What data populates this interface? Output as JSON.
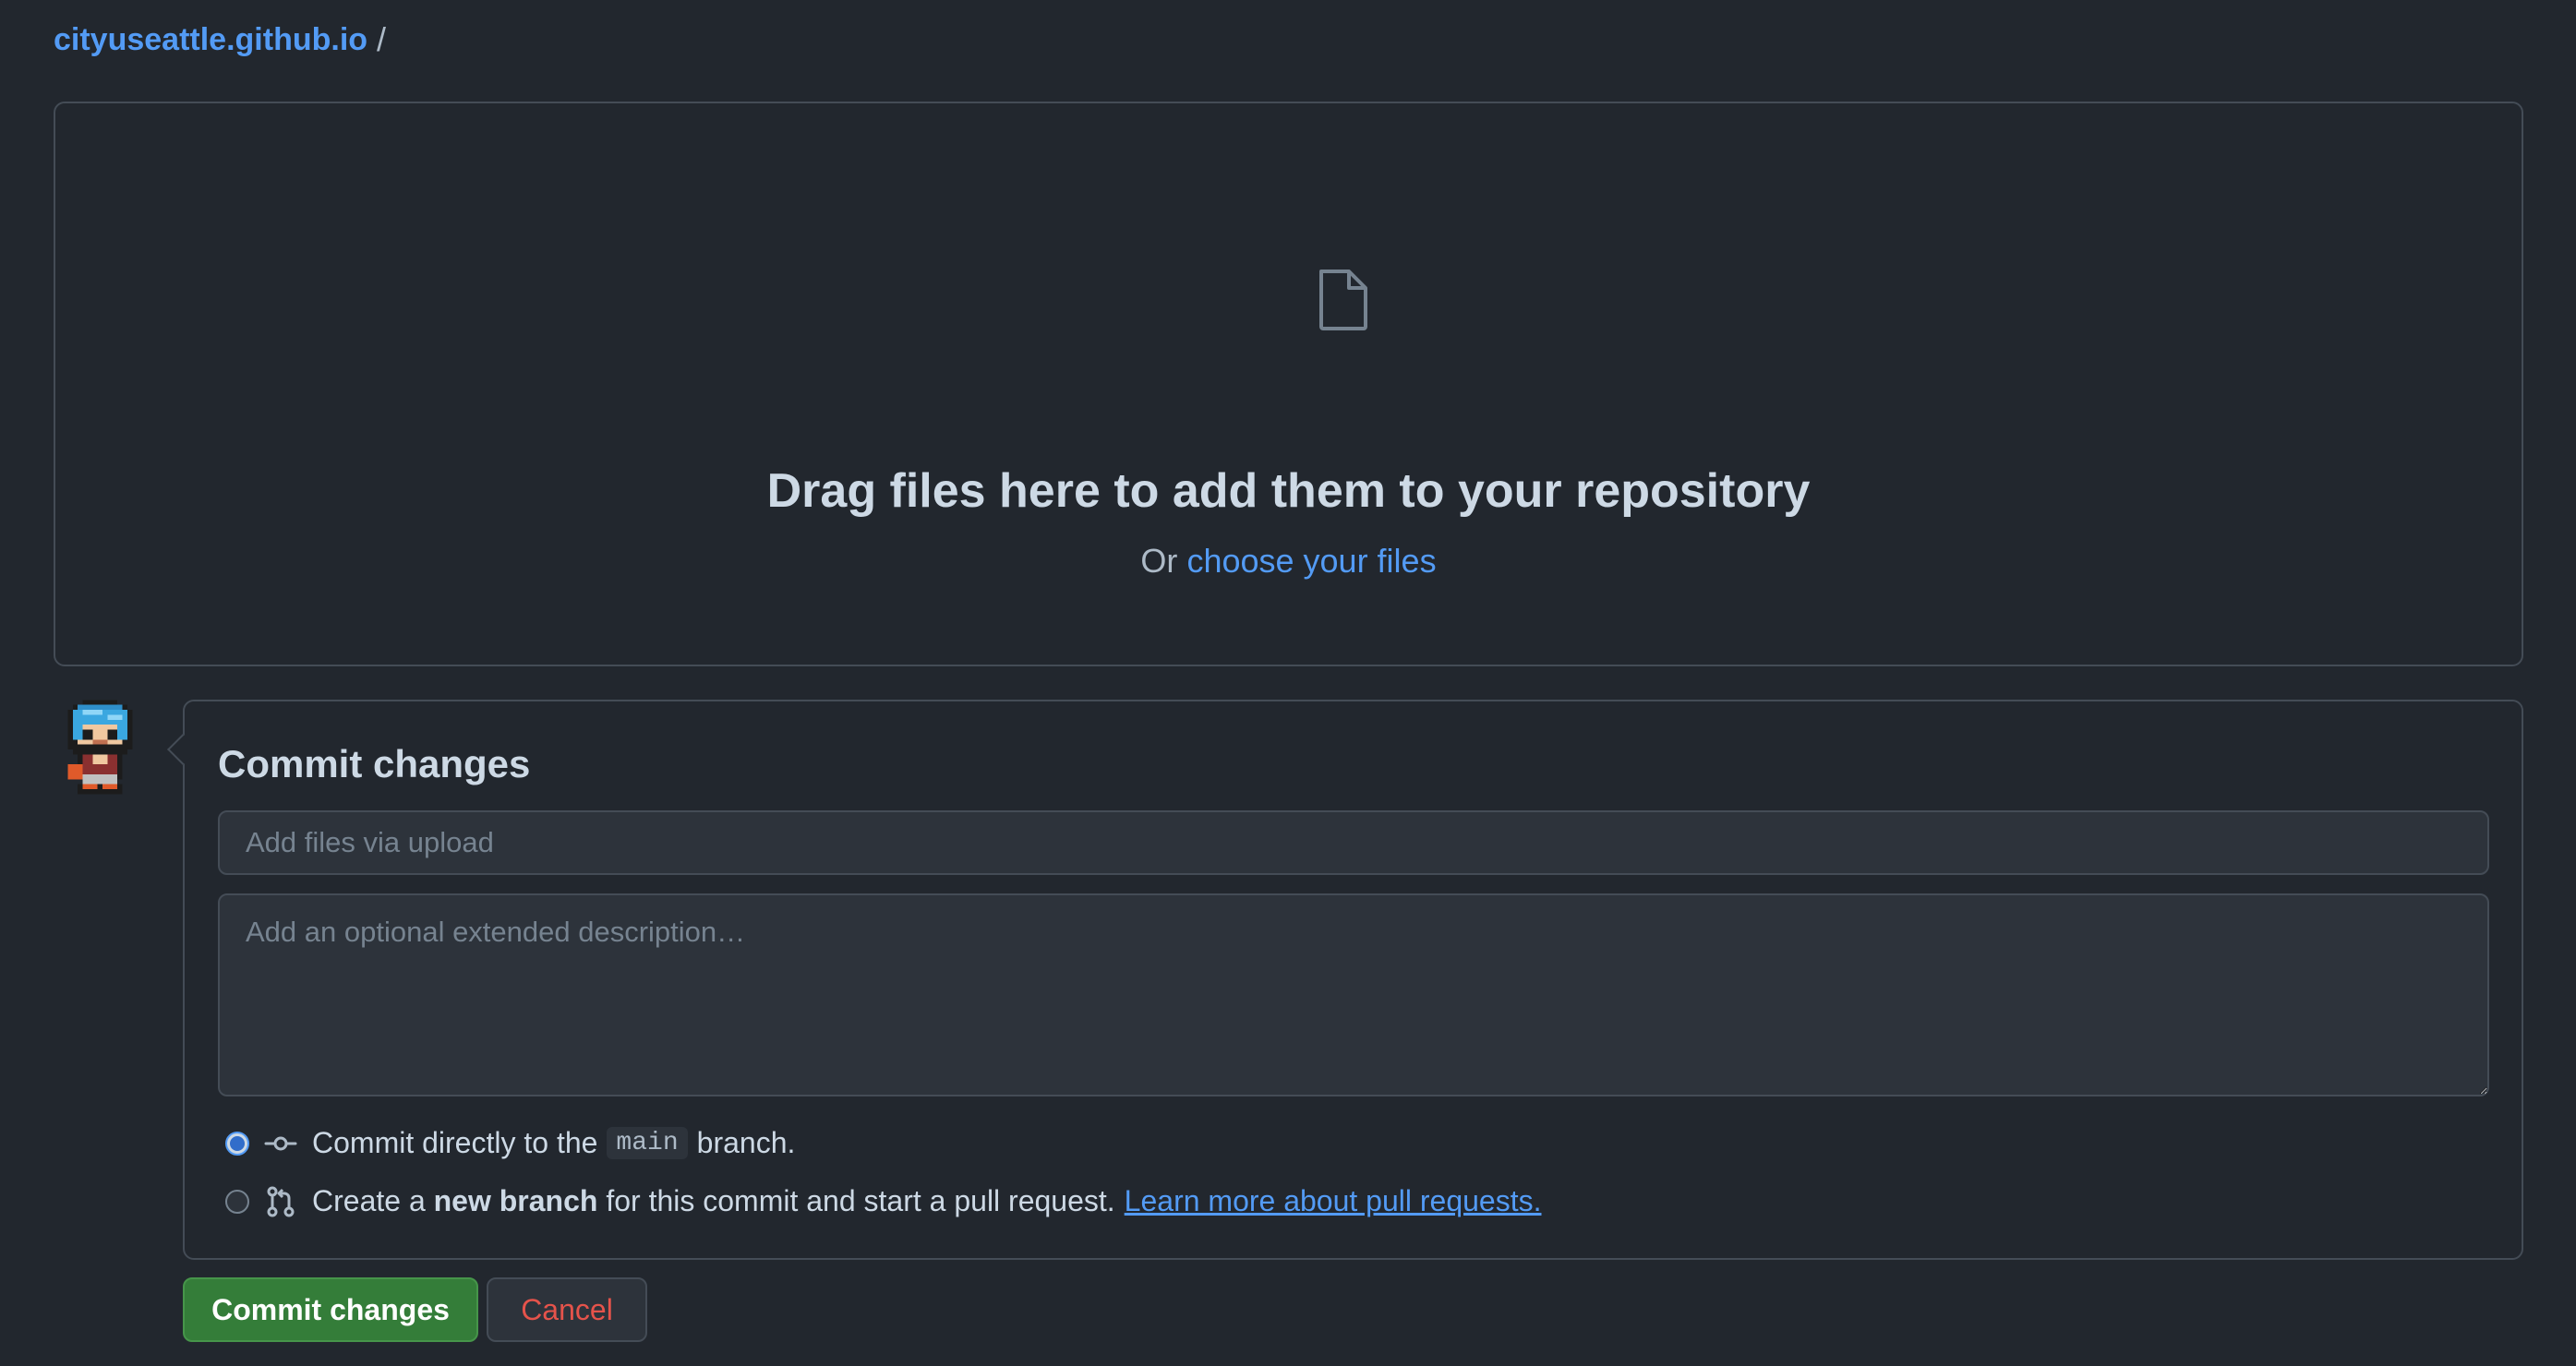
{
  "breadcrumb": {
    "repo": "cityuseattle.github.io",
    "separator": "/"
  },
  "dropzone": {
    "icon": "file-icon",
    "title": "Drag files here to add them to your repository",
    "prefix": "Or",
    "choose_link": "choose your files"
  },
  "commit": {
    "title": "Commit changes",
    "summary_placeholder": "Add files via upload",
    "description_placeholder": "Add an optional extended description…",
    "options": {
      "direct": {
        "icon": "git-commit-icon",
        "text_before": "Commit directly to the",
        "branch": "main",
        "text_after": "branch.",
        "selected": true
      },
      "new_branch": {
        "icon": "git-pull-request-icon",
        "text_before": "Create a",
        "bold": "new branch",
        "text_after": "for this commit and start a pull request.",
        "link": "Learn more about pull requests.",
        "selected": false
      }
    }
  },
  "buttons": {
    "commit": "Commit changes",
    "cancel": "Cancel"
  },
  "colors": {
    "background": "#22272e",
    "link": "#539bf5",
    "commit_button": "#347d39",
    "cancel_text": "#e5534b"
  }
}
